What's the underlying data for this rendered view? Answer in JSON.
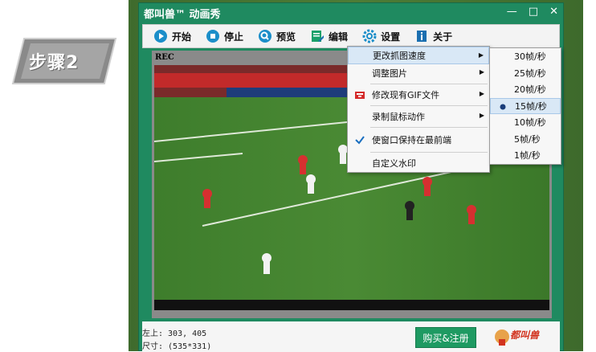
{
  "step_badge": {
    "label": "步骤2"
  },
  "window": {
    "title": "都叫兽™ 动画秀",
    "controls": {
      "minimize": "—",
      "maximize": "□",
      "close": "✕"
    }
  },
  "toolbar": {
    "start": "开始",
    "stop": "停止",
    "preview": "预览",
    "edit": "编辑",
    "settings": "设置",
    "about": "关于"
  },
  "capture": {
    "rec": "REC"
  },
  "status": {
    "position": "左上: 303, 405",
    "size": "尺寸: (535*331)"
  },
  "buy_button": "购买&注册",
  "logo": {
    "text": "都叫兽"
  },
  "settings_menu": {
    "items": [
      {
        "label": "更改抓图速度",
        "has_submenu": true,
        "highlighted": true
      },
      {
        "label": "调整图片",
        "has_submenu": true
      },
      {
        "label": "修改现有GIF文件",
        "has_submenu": true,
        "icon": "gif-edit-icon"
      },
      {
        "label": "录制鼠标动作",
        "has_submenu": true
      },
      {
        "label": "使窗口保持在最前端",
        "checked": true
      },
      {
        "label": "自定义水印"
      }
    ]
  },
  "speed_submenu": {
    "items": [
      {
        "label": "30帧/秒"
      },
      {
        "label": "25帧/秒"
      },
      {
        "label": "20帧/秒"
      },
      {
        "label": "15帧/秒",
        "selected": true
      },
      {
        "label": "10帧/秒"
      },
      {
        "label": "5帧/秒"
      },
      {
        "label": "1帧/秒"
      }
    ]
  },
  "colors": {
    "window_green": "#1f8a60",
    "menu_highlight": "#d9e8f6",
    "accent_blue": "#1a6fc0"
  }
}
